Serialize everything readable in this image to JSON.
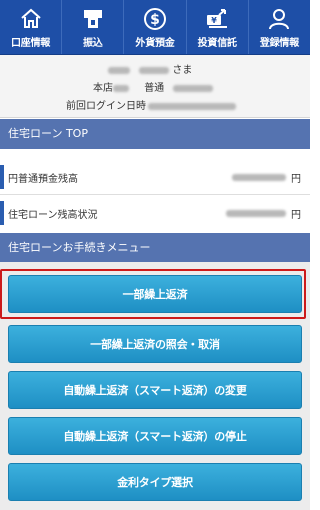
{
  "nav": [
    {
      "label": "口座情報",
      "icon": "home-icon"
    },
    {
      "label": "振込",
      "icon": "atm-transfer-icon"
    },
    {
      "label": "外貨預金",
      "icon": "dollar-coin-icon"
    },
    {
      "label": "投資信託",
      "icon": "investment-trust-icon"
    },
    {
      "label": "登録情報",
      "icon": "user-icon"
    }
  ],
  "customer": {
    "honorific": "さま",
    "branch_prefix": "本店",
    "account_type": "普通",
    "last_login_label": "前回ログイン日時"
  },
  "housing_loan": {
    "title": "住宅ローン TOP",
    "rows": [
      {
        "label": "円普通預金残高",
        "currency": "円"
      },
      {
        "label": "住宅ローン残高状況",
        "currency": "円"
      }
    ]
  },
  "procedure_menu": {
    "title": "住宅ローンお手続きメニュー",
    "buttons": [
      {
        "label": "一部繰上返済"
      },
      {
        "label": "一部繰上返済の照会・取消"
      },
      {
        "label": "自動繰上返済（スマート返済）の変更"
      },
      {
        "label": "自動繰上返済（スマート返済）の停止"
      },
      {
        "label": "金利タイプ選択"
      }
    ],
    "highlight_color": "#cc1a1a"
  },
  "colors": {
    "nav_bg": "#1e4fa7",
    "section_header": "#5573b0",
    "button": "#1e8fc4"
  }
}
